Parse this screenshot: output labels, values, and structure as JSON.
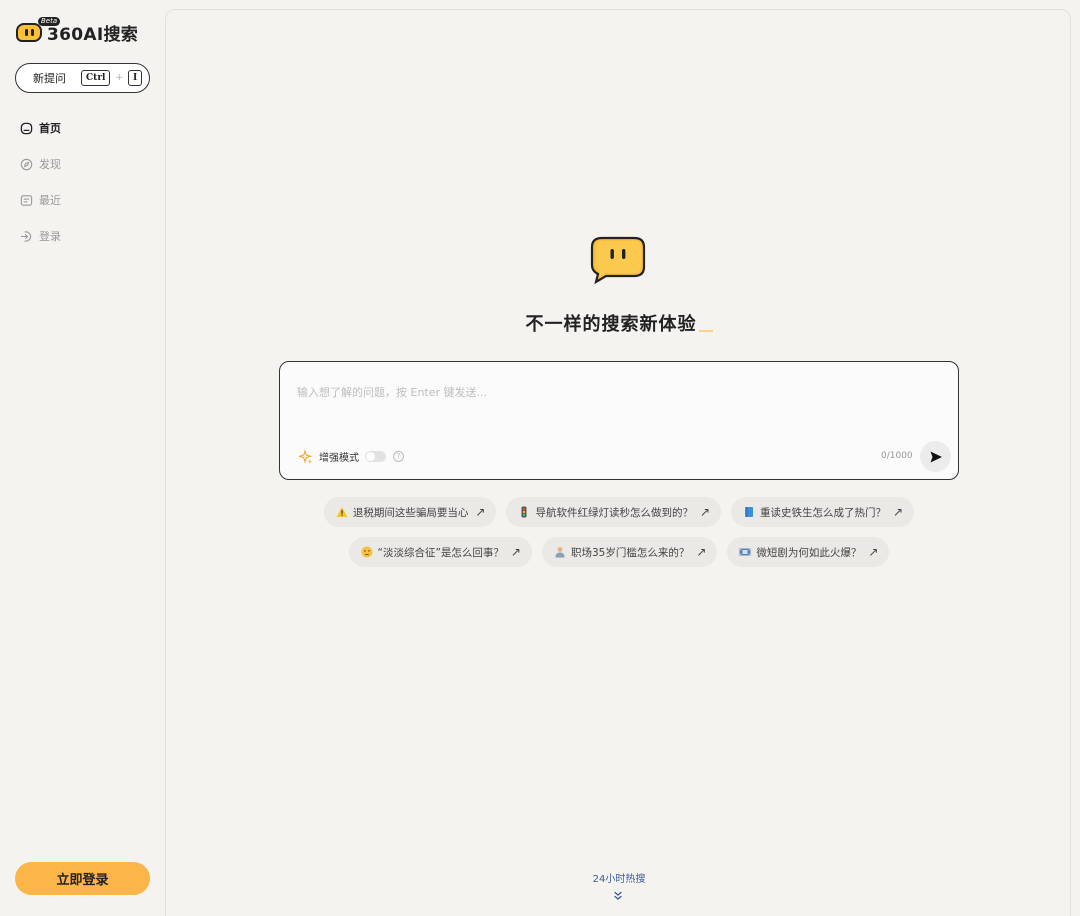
{
  "brand": {
    "name": "360AI搜索",
    "badge": "Beta",
    "accent": "#fbb548"
  },
  "sidebar": {
    "new_question": {
      "label": "新提问",
      "shortcut_key1": "Ctrl",
      "shortcut_plus": "+",
      "shortcut_key2": "I"
    },
    "items": [
      {
        "label": "首页",
        "icon": "home-icon",
        "active": true
      },
      {
        "label": "发现",
        "icon": "compass-icon",
        "active": false
      },
      {
        "label": "最近",
        "icon": "history-icon",
        "active": false
      },
      {
        "label": "登录",
        "icon": "login-icon",
        "active": false
      }
    ],
    "login_button": "立即登录"
  },
  "main": {
    "headline": "不一样的搜索新体验",
    "search": {
      "placeholder": "输入想了解的问题，按 Enter 键发送...",
      "value": "",
      "enhance_label": "增强模式",
      "enhance_on": false,
      "counter": "0/1000"
    },
    "suggestions_row1": [
      {
        "icon": "warning-icon",
        "text": "退税期间这些骗局要当心"
      },
      {
        "icon": "traffic-light-icon",
        "text": "导航软件红绿灯读秒怎么做到的？"
      },
      {
        "icon": "book-icon",
        "text": "重读史铁生怎么成了热门？"
      }
    ],
    "suggestions_row2": [
      {
        "icon": "face-icon",
        "text": "“淡淡综合征”是怎么回事？"
      },
      {
        "icon": "worker-icon",
        "text": "职场35岁门槛怎么来的？"
      },
      {
        "icon": "film-icon",
        "text": "微短剧为何如此火爆？"
      }
    ],
    "hot_label": "24小时热搜"
  }
}
